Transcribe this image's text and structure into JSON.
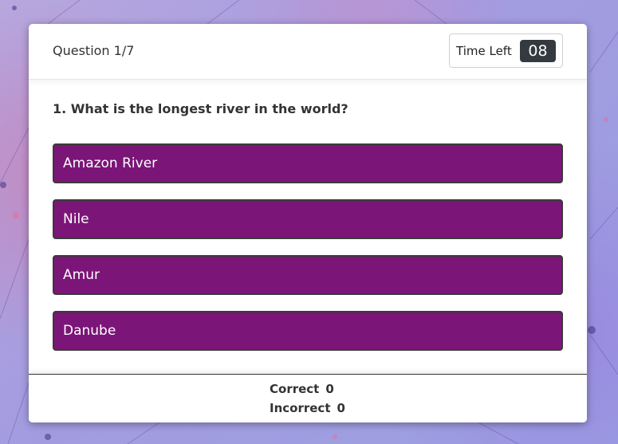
{
  "header": {
    "question_counter": "Question 1/7",
    "time_left_label": "Time Left",
    "time_left_value": "08"
  },
  "question": {
    "text": "1. What is the longest river in the world?"
  },
  "options": [
    {
      "label": "Amazon River"
    },
    {
      "label": "Nile"
    },
    {
      "label": "Amur"
    },
    {
      "label": "Danube"
    }
  ],
  "score": {
    "correct_label": "Correct",
    "correct_value": "0",
    "incorrect_label": "Incorrect",
    "incorrect_value": "0"
  },
  "colors": {
    "option_bg": "#7c1578",
    "timer_bg": "#343a40",
    "page_bg": "#a9a0d8"
  }
}
